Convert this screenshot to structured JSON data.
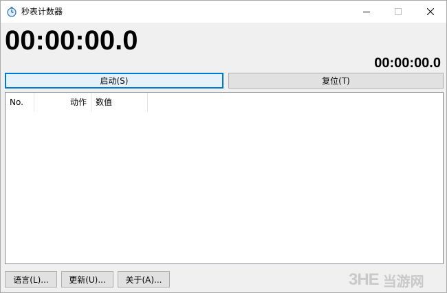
{
  "window": {
    "title": "秒表计数器"
  },
  "timer": {
    "main": "00:00:00.0",
    "lap": "00:00:00.0"
  },
  "buttons": {
    "start": "启动(S)",
    "reset": "复位(T)",
    "language": "语言(L)...",
    "update": "更新(U)...",
    "about": "关于(A)..."
  },
  "list": {
    "columns": [
      "No.",
      "动作",
      "数值"
    ]
  },
  "watermark": {
    "logo": "3HE",
    "text": "当游网"
  },
  "colors": {
    "accent": "#0078d7",
    "background": "#f0f0f0",
    "button": "#e1e1e1"
  }
}
